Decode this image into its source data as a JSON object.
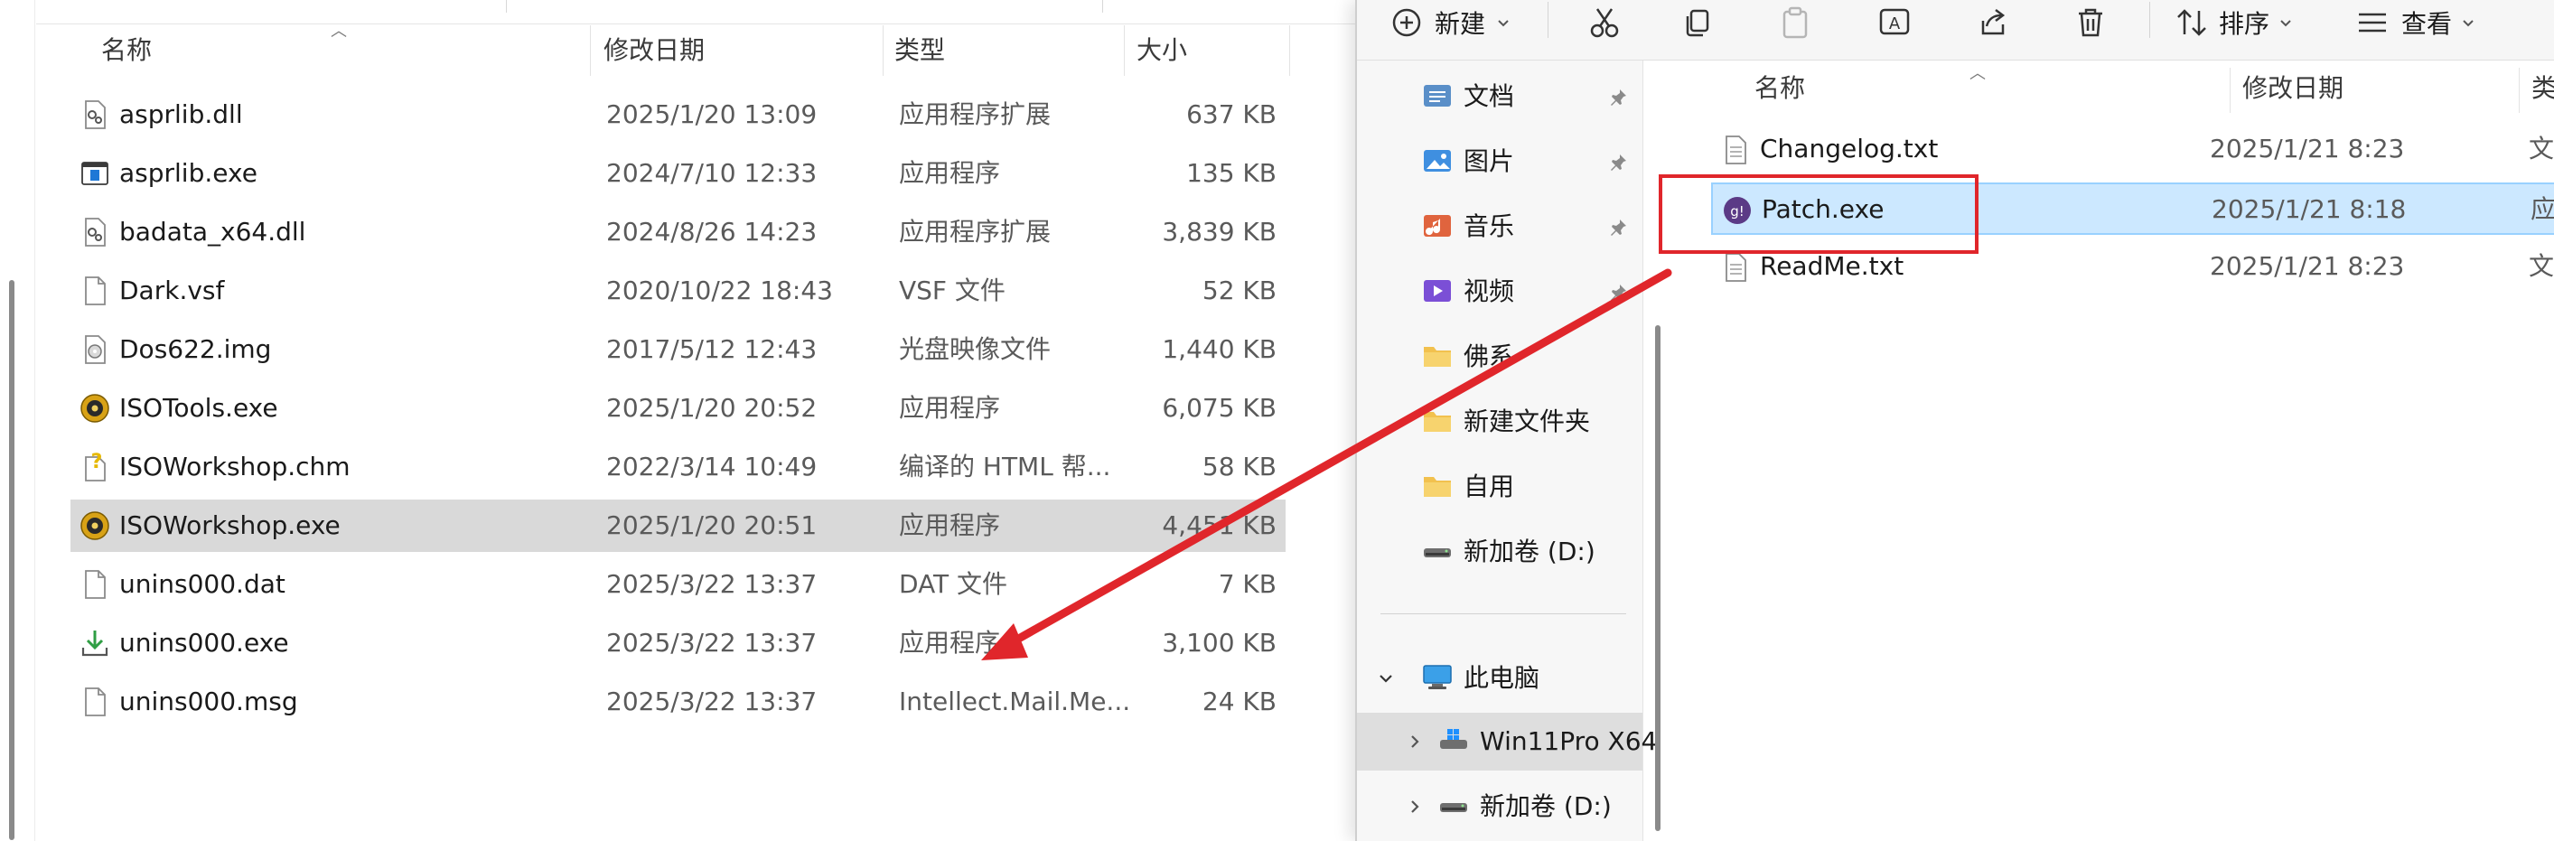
{
  "left_pane": {
    "columns": {
      "name": "名称",
      "date": "修改日期",
      "type": "类型",
      "size": "大小"
    },
    "files": [
      {
        "name": "asprlib.dll",
        "date": "2025/1/20 13:09",
        "type": "应用程序扩展",
        "size": "637 KB",
        "icon": "dll-gear-icon"
      },
      {
        "name": "asprlib.exe",
        "date": "2024/7/10 12:33",
        "type": "应用程序",
        "size": "135 KB",
        "icon": "exe-window-icon"
      },
      {
        "name": "badata_x64.dll",
        "date": "2024/8/26 14:23",
        "type": "应用程序扩展",
        "size": "3,839 KB",
        "icon": "dll-gear-icon"
      },
      {
        "name": "Dark.vsf",
        "date": "2020/10/22 18:43",
        "type": "VSF 文件",
        "size": "52 KB",
        "icon": "blank-file-icon"
      },
      {
        "name": "Dos622.img",
        "date": "2017/5/12 12:43",
        "type": "光盘映像文件",
        "size": "1,440 KB",
        "icon": "disc-image-icon"
      },
      {
        "name": "ISOTools.exe",
        "date": "2025/1/20 20:52",
        "type": "应用程序",
        "size": "6,075 KB",
        "icon": "iso-app-icon"
      },
      {
        "name": "ISOWorkshop.chm",
        "date": "2022/3/14 10:49",
        "type": "编译的 HTML 帮...",
        "size": "58 KB",
        "icon": "help-file-icon"
      },
      {
        "name": "ISOWorkshop.exe",
        "date": "2025/1/20 20:51",
        "type": "应用程序",
        "size": "4,451 KB",
        "icon": "iso-app-icon"
      },
      {
        "name": "unins000.dat",
        "date": "2025/3/22 13:37",
        "type": "DAT 文件",
        "size": "7 KB",
        "icon": "blank-file-icon"
      },
      {
        "name": "unins000.exe",
        "date": "2025/3/22 13:37",
        "type": "应用程序",
        "size": "3,100 KB",
        "icon": "uninstall-icon"
      },
      {
        "name": "unins000.msg",
        "date": "2025/3/22 13:37",
        "type": "Intellect.Mail.Me...",
        "size": "24 KB",
        "icon": "blank-file-icon"
      }
    ],
    "selected_index": 7
  },
  "right_window": {
    "toolbar": {
      "new_label": "新建",
      "sort_label": "排序",
      "view_label": "查看"
    },
    "nav": {
      "quick_access": [
        {
          "label": "文档",
          "icon": "documents-icon",
          "pinned": true
        },
        {
          "label": "图片",
          "icon": "pictures-icon",
          "pinned": true
        },
        {
          "label": "音乐",
          "icon": "music-icon",
          "pinned": true
        },
        {
          "label": "视频",
          "icon": "videos-icon",
          "pinned": true
        },
        {
          "label": "佛系",
          "icon": "folder-icon",
          "pinned": false
        },
        {
          "label": "新建文件夹",
          "icon": "folder-icon",
          "pinned": false
        },
        {
          "label": "自用",
          "icon": "folder-icon",
          "pinned": false
        },
        {
          "label": "新加卷 (D:)",
          "icon": "drive-icon",
          "pinned": false
        }
      ],
      "this_pc_label": "此电脑",
      "drives": [
        {
          "label": "Win11Pro X64",
          "icon": "windows-drive-icon"
        },
        {
          "label": "新加卷 (D:)",
          "icon": "drive-icon"
        }
      ]
    },
    "columns": {
      "name": "名称",
      "date": "修改日期",
      "type": "类"
    },
    "files": [
      {
        "name": "Changelog.txt",
        "date": "2025/1/21 8:23",
        "type": "文",
        "icon": "text-file-icon"
      },
      {
        "name": "Patch.exe",
        "date": "2025/1/21 8:18",
        "type": "应",
        "icon": "patch-app-icon"
      },
      {
        "name": "ReadMe.txt",
        "date": "2025/1/21 8:23",
        "type": "文",
        "icon": "text-file-icon"
      }
    ],
    "selected_index": 1
  },
  "colors": {
    "annotation_red": "#e0262b",
    "selection_blue": "#cce8ff",
    "selection_gray": "#d9d9d9"
  }
}
